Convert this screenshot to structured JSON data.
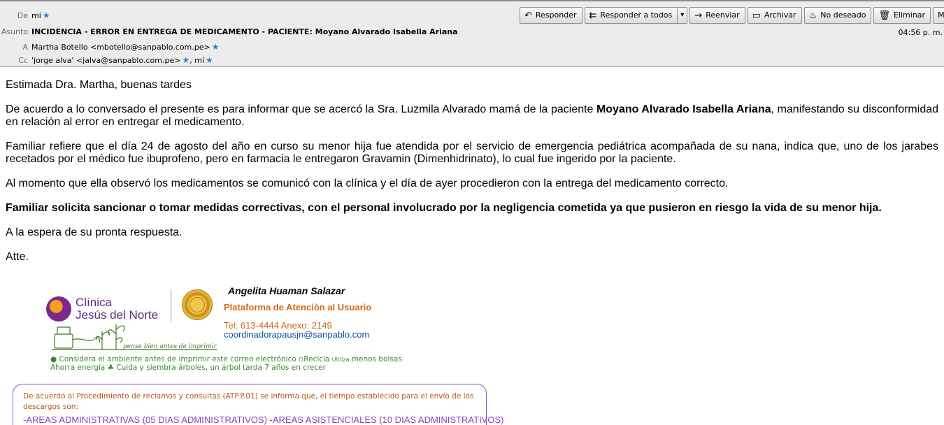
{
  "header": {
    "from_label": "De",
    "from_value": "mí",
    "subject_label": "Asunto",
    "subject": "INCIDENCIA - ERROR EN ENTREGA DE MEDICAMENTO - PACIENTE: Moyano Alvarado Isabella Ariana",
    "to_label": "A",
    "to_value": "Martha Botello <mbotello@sanpablo.com.pe>",
    "cc_label": "Cc",
    "cc_value": "'jorge alva' <jalva@sanpablo.com.pe>",
    "cc_extra": ", mí",
    "time": "04:56 p. m."
  },
  "toolbar": {
    "reply": "Responder",
    "reply_all": "Responder a todos",
    "forward": "Reenviar",
    "archive": "Archivar",
    "junk": "No deseado",
    "delete": "Eliminar",
    "more": "Más"
  },
  "body": {
    "greeting": "Estimada Dra. Martha, buenas tardes",
    "p1_before": "De acuerdo a lo conversado el presente es para informar que se acercó la Sra. Luzmila Alvarado mamá de la paciente ",
    "p1_bold": "Moyano Alvarado Isabella Ariana",
    "p1_after": ", manifestando su disconformidad en relación al error en entregar el medicamento.",
    "p2": "Familiar refiere que el día 24 de agosto del año en curso su menor hija fue atendida por el servicio de emergencia pediátrica acompañada de su nana, indica que, uno de los jarabes recetados por el médico fue ibuprofeno, pero en farmacia le entregaron Gravamin (Dimenhidrinato), lo cual fue ingerido por la paciente.",
    "p3": "Al momento que ella observó los medicamentos se comunicó con la clínica y el día de ayer procedieron con la entrega del medicamento correcto.",
    "p4": "Familiar solicita sancionar o tomar medidas correctivas, con el personal involucrado por la negligencia cometida ya que pusieron en riesgo la vida de su menor hija.",
    "p5": "A la espera de su pronta respuesta.",
    "signoff": "Atte."
  },
  "signature": {
    "logo_line1": "Clínica",
    "logo_line2": "Jesús del Norte",
    "name": "Angelita Huaman Salazar",
    "role": "Plataforma de Atenciòn al Usuario",
    "tel": "Tel: 613-4444   Anexo: 2149",
    "email": "coordinadorapausjn@sanpablo.com",
    "slogan": "pense bien antes de imprimir",
    "eco1": "Considera el ambiente antes de imprimir este correo electrónico",
    "eco1_b": "Recicla",
    "eco1_small": "Utiliza",
    "eco1_c": "menos bolsas",
    "eco2_a": "Ahorra energía",
    "eco2_b": "Cuida y siembra árboles, un árbol tarda 7 años en crecer"
  },
  "notice": {
    "text": "De acuerdo al Procedimiento de reclamos y consultas (ATP.P.01) se informa que, el tiempo establecido para el envío de los descargos son:",
    "areas": "-AREAS ADMINISTRATIVAS (05 DIAS ADMINISTRATIVOS)  -AREAS ASISTENCIALES (10 DIAS ADMINISTRATIVOS)"
  },
  "colors": {
    "star": "#2a7ed6",
    "brand_purple": "#5c2d82",
    "signature_orange": "#d06a1a",
    "link_blue": "#1f4ea3",
    "eco_green": "#3a8a2e"
  }
}
